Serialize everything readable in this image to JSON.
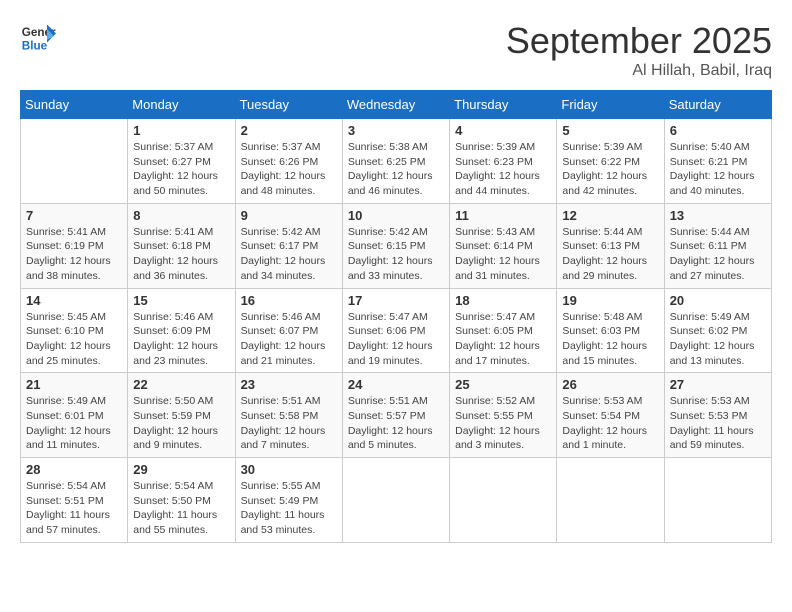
{
  "header": {
    "logo_general": "General",
    "logo_blue": "Blue",
    "month_title": "September 2025",
    "location": "Al Hillah, Babil, Iraq"
  },
  "days_of_week": [
    "Sunday",
    "Monday",
    "Tuesday",
    "Wednesday",
    "Thursday",
    "Friday",
    "Saturday"
  ],
  "weeks": [
    [
      {
        "day": "",
        "info": ""
      },
      {
        "day": "1",
        "info": "Sunrise: 5:37 AM\nSunset: 6:27 PM\nDaylight: 12 hours\nand 50 minutes."
      },
      {
        "day": "2",
        "info": "Sunrise: 5:37 AM\nSunset: 6:26 PM\nDaylight: 12 hours\nand 48 minutes."
      },
      {
        "day": "3",
        "info": "Sunrise: 5:38 AM\nSunset: 6:25 PM\nDaylight: 12 hours\nand 46 minutes."
      },
      {
        "day": "4",
        "info": "Sunrise: 5:39 AM\nSunset: 6:23 PM\nDaylight: 12 hours\nand 44 minutes."
      },
      {
        "day": "5",
        "info": "Sunrise: 5:39 AM\nSunset: 6:22 PM\nDaylight: 12 hours\nand 42 minutes."
      },
      {
        "day": "6",
        "info": "Sunrise: 5:40 AM\nSunset: 6:21 PM\nDaylight: 12 hours\nand 40 minutes."
      }
    ],
    [
      {
        "day": "7",
        "info": "Sunrise: 5:41 AM\nSunset: 6:19 PM\nDaylight: 12 hours\nand 38 minutes."
      },
      {
        "day": "8",
        "info": "Sunrise: 5:41 AM\nSunset: 6:18 PM\nDaylight: 12 hours\nand 36 minutes."
      },
      {
        "day": "9",
        "info": "Sunrise: 5:42 AM\nSunset: 6:17 PM\nDaylight: 12 hours\nand 34 minutes."
      },
      {
        "day": "10",
        "info": "Sunrise: 5:42 AM\nSunset: 6:15 PM\nDaylight: 12 hours\nand 33 minutes."
      },
      {
        "day": "11",
        "info": "Sunrise: 5:43 AM\nSunset: 6:14 PM\nDaylight: 12 hours\nand 31 minutes."
      },
      {
        "day": "12",
        "info": "Sunrise: 5:44 AM\nSunset: 6:13 PM\nDaylight: 12 hours\nand 29 minutes."
      },
      {
        "day": "13",
        "info": "Sunrise: 5:44 AM\nSunset: 6:11 PM\nDaylight: 12 hours\nand 27 minutes."
      }
    ],
    [
      {
        "day": "14",
        "info": "Sunrise: 5:45 AM\nSunset: 6:10 PM\nDaylight: 12 hours\nand 25 minutes."
      },
      {
        "day": "15",
        "info": "Sunrise: 5:46 AM\nSunset: 6:09 PM\nDaylight: 12 hours\nand 23 minutes."
      },
      {
        "day": "16",
        "info": "Sunrise: 5:46 AM\nSunset: 6:07 PM\nDaylight: 12 hours\nand 21 minutes."
      },
      {
        "day": "17",
        "info": "Sunrise: 5:47 AM\nSunset: 6:06 PM\nDaylight: 12 hours\nand 19 minutes."
      },
      {
        "day": "18",
        "info": "Sunrise: 5:47 AM\nSunset: 6:05 PM\nDaylight: 12 hours\nand 17 minutes."
      },
      {
        "day": "19",
        "info": "Sunrise: 5:48 AM\nSunset: 6:03 PM\nDaylight: 12 hours\nand 15 minutes."
      },
      {
        "day": "20",
        "info": "Sunrise: 5:49 AM\nSunset: 6:02 PM\nDaylight: 12 hours\nand 13 minutes."
      }
    ],
    [
      {
        "day": "21",
        "info": "Sunrise: 5:49 AM\nSunset: 6:01 PM\nDaylight: 12 hours\nand 11 minutes."
      },
      {
        "day": "22",
        "info": "Sunrise: 5:50 AM\nSunset: 5:59 PM\nDaylight: 12 hours\nand 9 minutes."
      },
      {
        "day": "23",
        "info": "Sunrise: 5:51 AM\nSunset: 5:58 PM\nDaylight: 12 hours\nand 7 minutes."
      },
      {
        "day": "24",
        "info": "Sunrise: 5:51 AM\nSunset: 5:57 PM\nDaylight: 12 hours\nand 5 minutes."
      },
      {
        "day": "25",
        "info": "Sunrise: 5:52 AM\nSunset: 5:55 PM\nDaylight: 12 hours\nand 3 minutes."
      },
      {
        "day": "26",
        "info": "Sunrise: 5:53 AM\nSunset: 5:54 PM\nDaylight: 12 hours\nand 1 minute."
      },
      {
        "day": "27",
        "info": "Sunrise: 5:53 AM\nSunset: 5:53 PM\nDaylight: 11 hours\nand 59 minutes."
      }
    ],
    [
      {
        "day": "28",
        "info": "Sunrise: 5:54 AM\nSunset: 5:51 PM\nDaylight: 11 hours\nand 57 minutes."
      },
      {
        "day": "29",
        "info": "Sunrise: 5:54 AM\nSunset: 5:50 PM\nDaylight: 11 hours\nand 55 minutes."
      },
      {
        "day": "30",
        "info": "Sunrise: 5:55 AM\nSunset: 5:49 PM\nDaylight: 11 hours\nand 53 minutes."
      },
      {
        "day": "",
        "info": ""
      },
      {
        "day": "",
        "info": ""
      },
      {
        "day": "",
        "info": ""
      },
      {
        "day": "",
        "info": ""
      }
    ]
  ]
}
